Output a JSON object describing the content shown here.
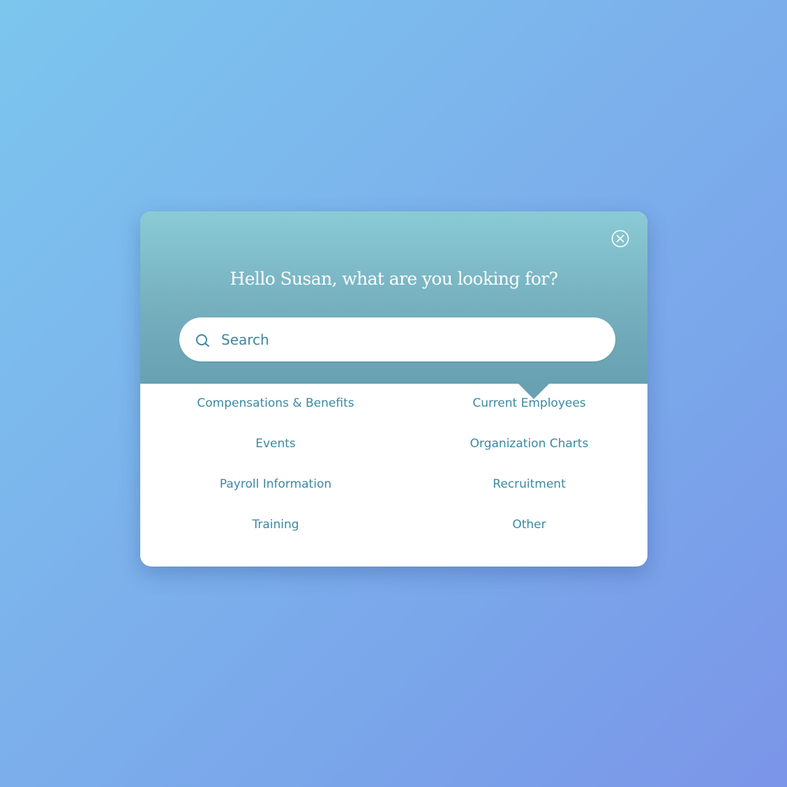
{
  "dialog": {
    "greeting": "Hello Susan, what are you looking for?",
    "close_icon": "close-circle-icon",
    "search": {
      "icon": "search-icon",
      "placeholder": "Search",
      "value": ""
    },
    "options": [
      {
        "label": "Compensations & Benefits"
      },
      {
        "label": "Current Employees"
      },
      {
        "label": "Events"
      },
      {
        "label": "Organization Charts"
      },
      {
        "label": "Payroll Information"
      },
      {
        "label": "Recruitment"
      },
      {
        "label": "Training"
      },
      {
        "label": "Other"
      }
    ]
  },
  "colors": {
    "background_start": "#7cc6ee",
    "background_end": "#7b95e8",
    "header_top": "#8acbd5",
    "header_bottom": "#67a1b2",
    "link_text": "#3b89a1",
    "panel": "#ffffff"
  }
}
